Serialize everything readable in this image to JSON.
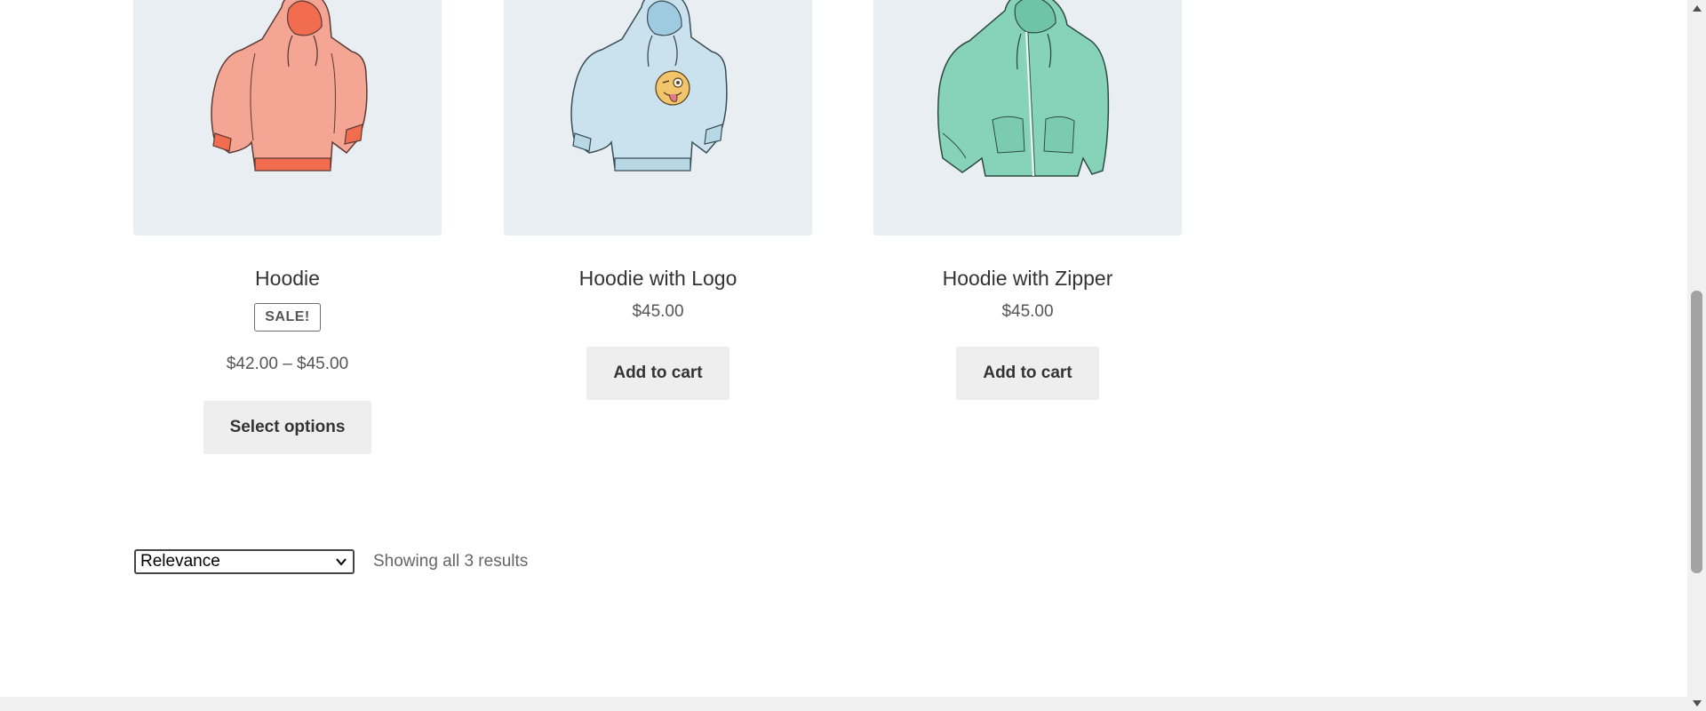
{
  "products": [
    {
      "image_alt": "orange-hoodie",
      "title": "Hoodie",
      "badge": "SALE!",
      "price": "$42.00 – $45.00",
      "button": "Select options",
      "color": "#f4a594"
    },
    {
      "image_alt": "blue-hoodie-with-logo",
      "title": "Hoodie with Logo",
      "price": "$45.00",
      "button": "Add to cart",
      "color": "#c9e2ee"
    },
    {
      "image_alt": "green-hoodie-with-zipper",
      "title": "Hoodie with Zipper",
      "price": "$45.00",
      "button": "Add to cart",
      "color": "#86d3b9"
    }
  ],
  "sorting": {
    "selected": "Relevance"
  },
  "result_count": "Showing all 3 results",
  "colors": {
    "thumb_bg": "#e9eef2",
    "button_bg": "#eeeeee",
    "text": "#333333",
    "muted": "#666666"
  }
}
